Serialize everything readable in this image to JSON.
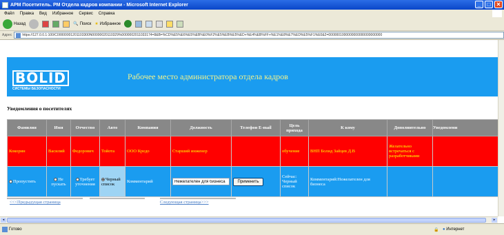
{
  "window": {
    "title": "АРМ Посетитель. РМ Отдела кадров компании - Microsoft Internet Explorer"
  },
  "menu": [
    "Файл",
    "Правка",
    "Вид",
    "Избранное",
    "Сервис",
    "Справка"
  ],
  "toolbar": {
    "back": "Назад",
    "search": "Поиск",
    "favorites": "Избранное"
  },
  "address": {
    "label": "Адрес",
    "url": "https://127.0.0.1:100/C00000001201103300N00000020110329%0000002011033174=8&B=%CD%E5%E6%E5%EB%E0%F2%E5%EB%E5%ED+%E4%EB%FF+%E1%E8%E7%ED%E5%F1%E0&2=0000001000000000000000000000"
  },
  "banner": {
    "logo": "BOLID",
    "logo_sub": "СИСТЕМЫ БЕЗОПАСНОСТИ",
    "title": "Рабочее место администратора отдела кадров"
  },
  "section_title": "Уведомления о посетителях",
  "columns": [
    "Фамилия",
    "Имя",
    "Отчество",
    "Авто",
    "Компания",
    "Должность",
    "Телефон E-mail",
    "Цель прихода",
    "К кому",
    "Дополнительно",
    "Уведомлени"
  ],
  "row1": {
    "last_name": "Кокорин",
    "first_name": "Василий",
    "middle_name": "Федорович",
    "auto": "Тойота",
    "company": "ООО Кредо",
    "position": "Старший инженер",
    "contacts": "",
    "purpose": "обучение",
    "to_whom": "ВНП Болид Зайцев Д.В",
    "extra": "Желательно встречаться с разработчиками",
    "notify": ""
  },
  "row2": {
    "opt_allow": "Пропустить",
    "opt_deny": "Не пускать",
    "opt_clarify": "Требует уточнения",
    "opt_blacklist": "Черный список",
    "comment_label": "Комментарий",
    "comment_value": "Нежелателен для бизнеса",
    "apply": "Применить",
    "status": "Сейчас: Черный список",
    "comment_text": "Комментарий:Нежелателен для бизнеса"
  },
  "pager": {
    "prev": "<<<Предыдущая страница",
    "next": "Следующая страница>>>"
  },
  "status": {
    "left": "Готово",
    "zone": "Интернет"
  },
  "colors": {
    "banner": "#1a9cf0",
    "red_row": "#ff0000",
    "header": "#888888"
  }
}
